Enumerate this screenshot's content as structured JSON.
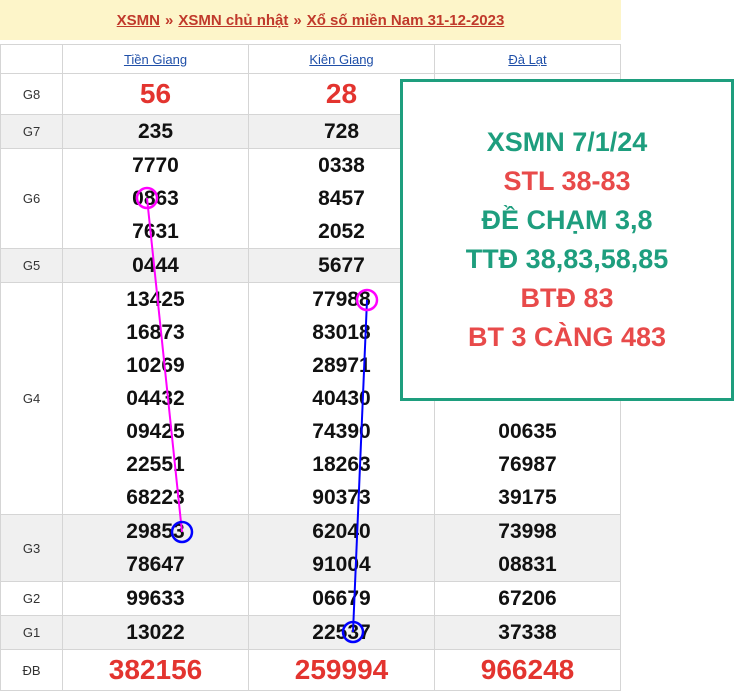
{
  "breadcrumb": {
    "items": [
      "XSMN",
      "XSMN chủ nhật",
      "Xổ số miền Nam 31-12-2023"
    ],
    "separator": "»"
  },
  "table": {
    "columns": [
      "Tiền Giang",
      "Kiên Giang",
      "Đà Lạt"
    ],
    "rows": [
      {
        "label": "G8",
        "values": [
          [
            "56"
          ],
          [
            "28"
          ],
          [
            ""
          ]
        ]
      },
      {
        "label": "G7",
        "values": [
          [
            "235"
          ],
          [
            "728"
          ],
          [
            ""
          ]
        ]
      },
      {
        "label": "G6",
        "values": [
          [
            "7770",
            "0863",
            "7631"
          ],
          [
            "0338",
            "8457",
            "2052"
          ],
          [
            "",
            "",
            ""
          ]
        ]
      },
      {
        "label": "G5",
        "values": [
          [
            "0444"
          ],
          [
            "5677"
          ],
          [
            ""
          ]
        ]
      },
      {
        "label": "G4",
        "values": [
          [
            "13425",
            "16873",
            "10269",
            "04432",
            "09425",
            "22551",
            "68223"
          ],
          [
            "77988",
            "83018",
            "28971",
            "40430",
            "74390",
            "18263",
            "90373"
          ],
          [
            "",
            "",
            "",
            "",
            "00635",
            "76987",
            "39175"
          ]
        ]
      },
      {
        "label": "G3",
        "values": [
          [
            "29853",
            "78647"
          ],
          [
            "62040",
            "91004"
          ],
          [
            "73998",
            "08831"
          ]
        ]
      },
      {
        "label": "G2",
        "values": [
          [
            "99633"
          ],
          [
            "06679"
          ],
          [
            "67206"
          ]
        ]
      },
      {
        "label": "G1",
        "values": [
          [
            "13022"
          ],
          [
            "22537"
          ],
          [
            "37338"
          ]
        ]
      },
      {
        "label": "ĐB",
        "values": [
          [
            "382156"
          ],
          [
            "259994"
          ],
          [
            "966248"
          ]
        ]
      }
    ]
  },
  "promo": {
    "lines": [
      "XSMN 7/1/24",
      "STL 38-83",
      "ĐỀ CHẠM 3,8",
      "TTĐ 38,83,58,85",
      "BTĐ 83",
      "BT 3 CÀNG 483"
    ],
    "border_color": "#1e9e7e",
    "colors": [
      "#1e9e7e",
      "#e84a4a",
      "#1e9e7e",
      "#1e9e7e",
      "#e84a4a",
      "#e84a4a"
    ]
  },
  "annotations": {
    "line1_color": "#ff00ff",
    "line2_color": "#0000ff"
  }
}
